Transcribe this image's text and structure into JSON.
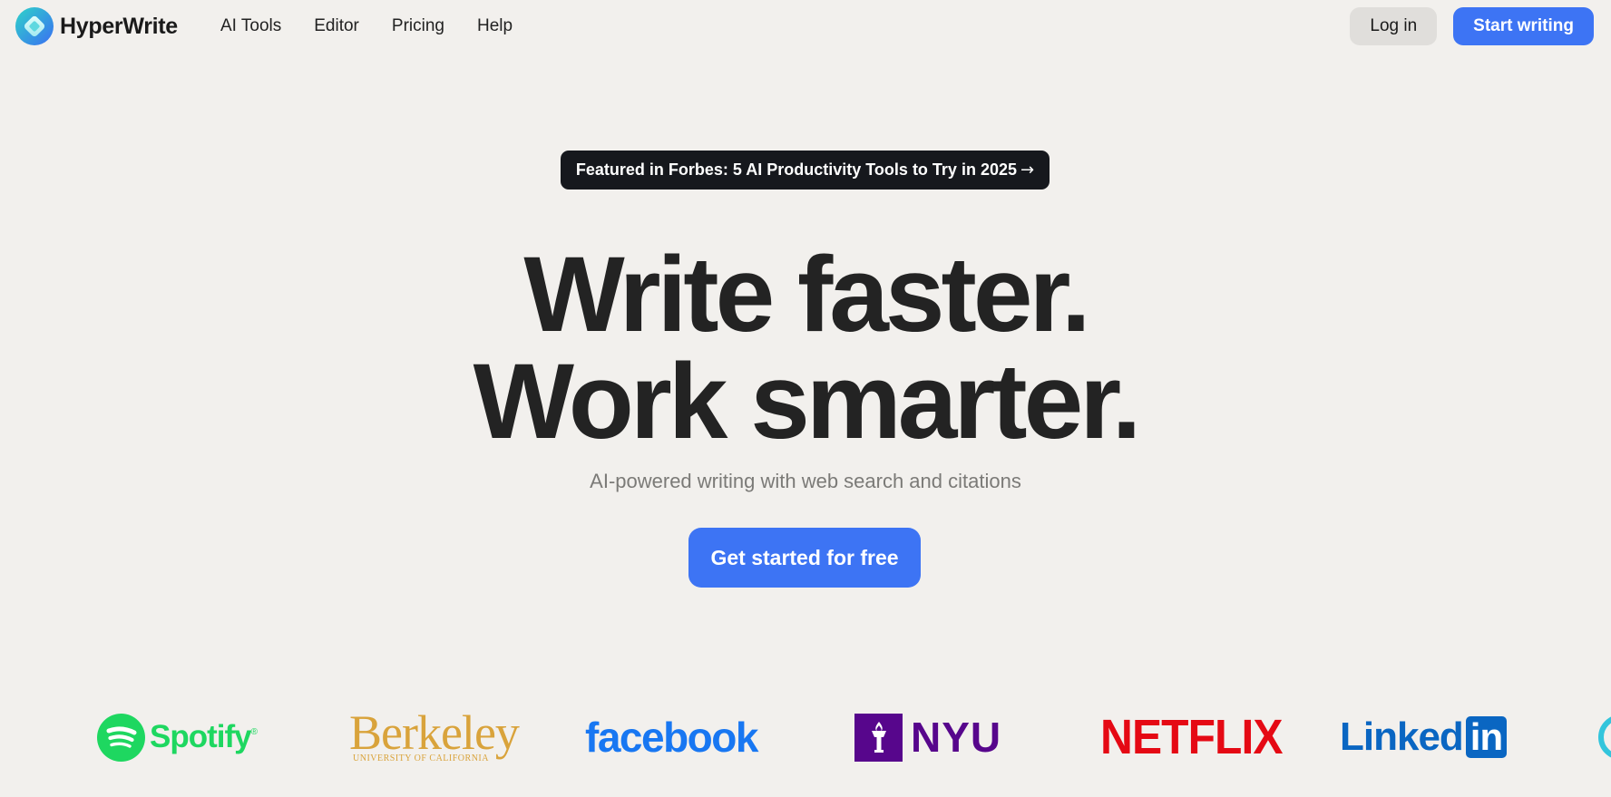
{
  "brand": {
    "name": "HyperWrite",
    "logo_icon": "hyperwrite-logo-icon",
    "colors": {
      "gradient_start": "#2fd3c9",
      "gradient_end": "#3a6ff2"
    }
  },
  "nav": {
    "links": [
      {
        "label": "AI Tools"
      },
      {
        "label": "Editor"
      },
      {
        "label": "Pricing"
      },
      {
        "label": "Help"
      }
    ],
    "login_label": "Log in",
    "start_label": "Start writing"
  },
  "hero": {
    "announcement": "Featured in Forbes: 5 AI Productivity Tools to Try in 2025",
    "announcement_arrow": "→",
    "headline_line1": "Write faster.",
    "headline_line2": "Work smarter.",
    "subheadline": "AI-powered writing with web search and citations",
    "cta_label": "Get started for free"
  },
  "logos": {
    "spotify": {
      "word": "Spotify",
      "mark": "®",
      "color": "#1ed760"
    },
    "berkeley": {
      "word": "Berkeley",
      "sub": "UNIVERSITY OF CALIFORNIA",
      "color": "#d9a33b"
    },
    "facebook": {
      "word": "facebook",
      "color": "#1877f2"
    },
    "nyu": {
      "word": "NYU",
      "icon": "nyu-torch-icon",
      "color": "#57068c"
    },
    "netflix": {
      "word": "NETFLIX",
      "color": "#e50914"
    },
    "linkedin": {
      "word": "Linked",
      "box": "in",
      "color": "#0a66c2"
    }
  },
  "colors": {
    "background": "#f2f0ed",
    "accent": "#3d74f4",
    "announcement_bg": "#16181d",
    "headline": "#232323",
    "subheadline": "#7b7a77"
  }
}
